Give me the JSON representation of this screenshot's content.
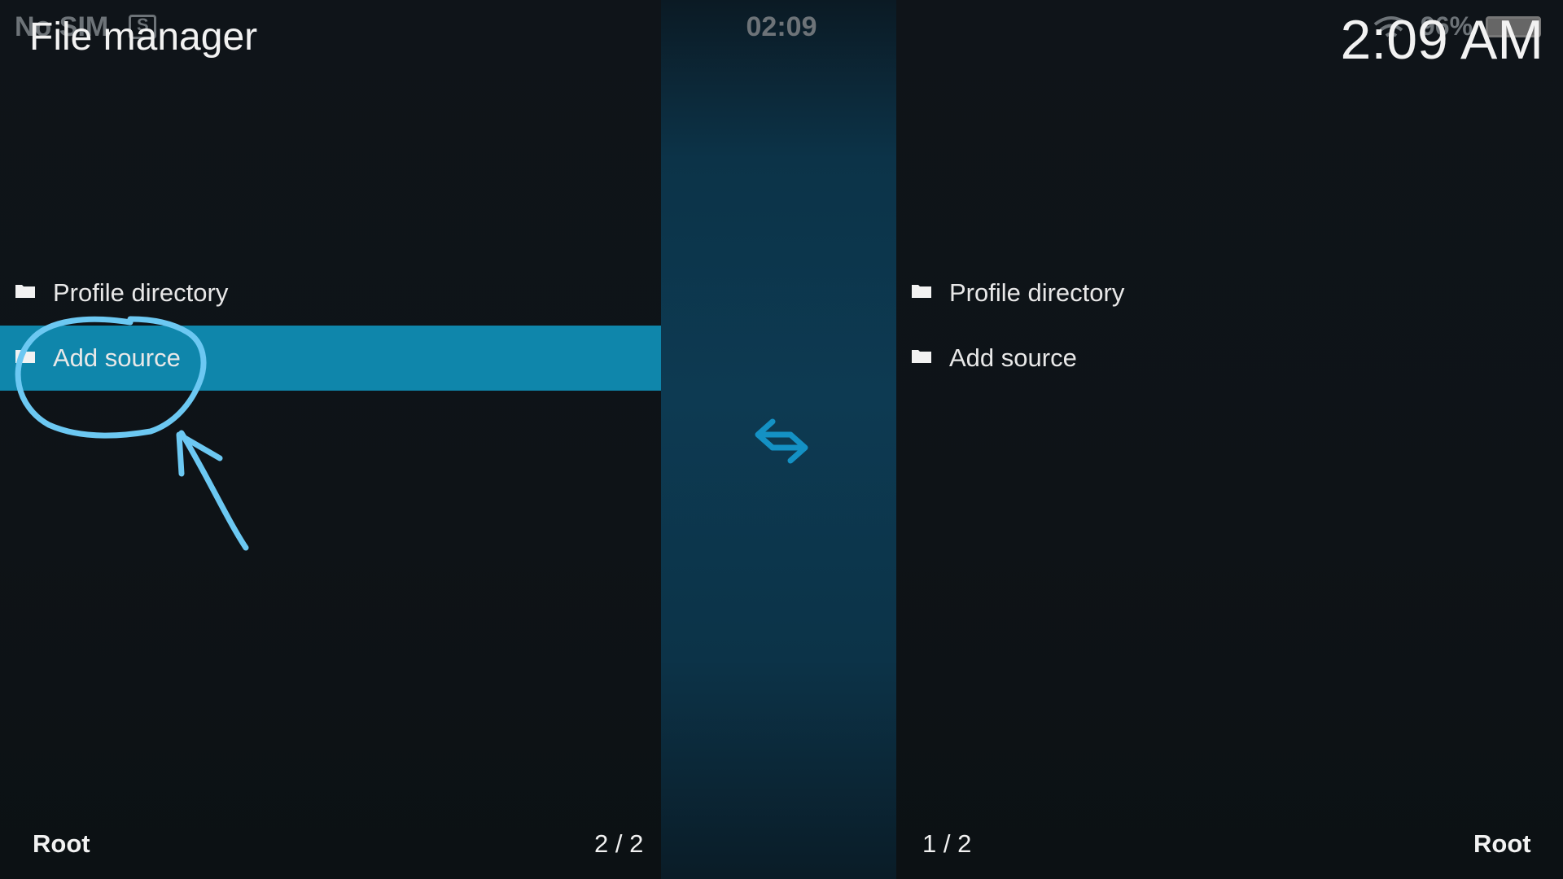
{
  "status_bar": {
    "carrier": "No SIM",
    "time": "02:09",
    "battery": "96%"
  },
  "header": {
    "title": "File manager",
    "clock": "2:09 AM"
  },
  "left_pane": {
    "items": [
      {
        "label": "Profile directory",
        "icon": "folder-icon"
      },
      {
        "label": "Add source",
        "icon": "folder-icon",
        "selected": true
      }
    ],
    "path": "Root",
    "position": "2 / 2"
  },
  "right_pane": {
    "items": [
      {
        "label": "Profile directory",
        "icon": "folder-icon"
      },
      {
        "label": "Add source",
        "icon": "folder-icon"
      }
    ],
    "path": "Root",
    "position": "1 / 2"
  },
  "colors": {
    "highlight": "#0f86ab",
    "annotation": "#6cc8f2",
    "accent": "#1491c4"
  }
}
